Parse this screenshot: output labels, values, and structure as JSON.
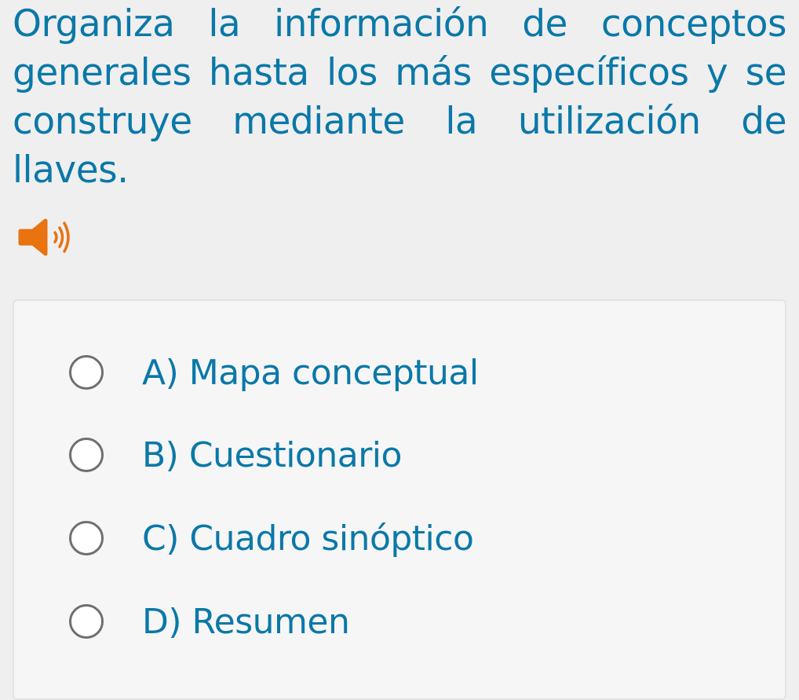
{
  "question": {
    "text": "Organiza la información de conceptos generales hasta los más específicos y se construye mediante la utilización de llaves."
  },
  "audio": {
    "icon": "speaker-icon",
    "color": "#e87310"
  },
  "options": [
    {
      "label": "A) Mapa conceptual"
    },
    {
      "label": "B) Cuestionario"
    },
    {
      "label": "C) Cuadro sinóptico"
    },
    {
      "label": "D) Resumen"
    }
  ],
  "colors": {
    "text": "#0a78a8",
    "background": "#efefef",
    "card": "#f6f6f6",
    "radio_border": "#6f6f6f",
    "accent": "#e87310"
  }
}
